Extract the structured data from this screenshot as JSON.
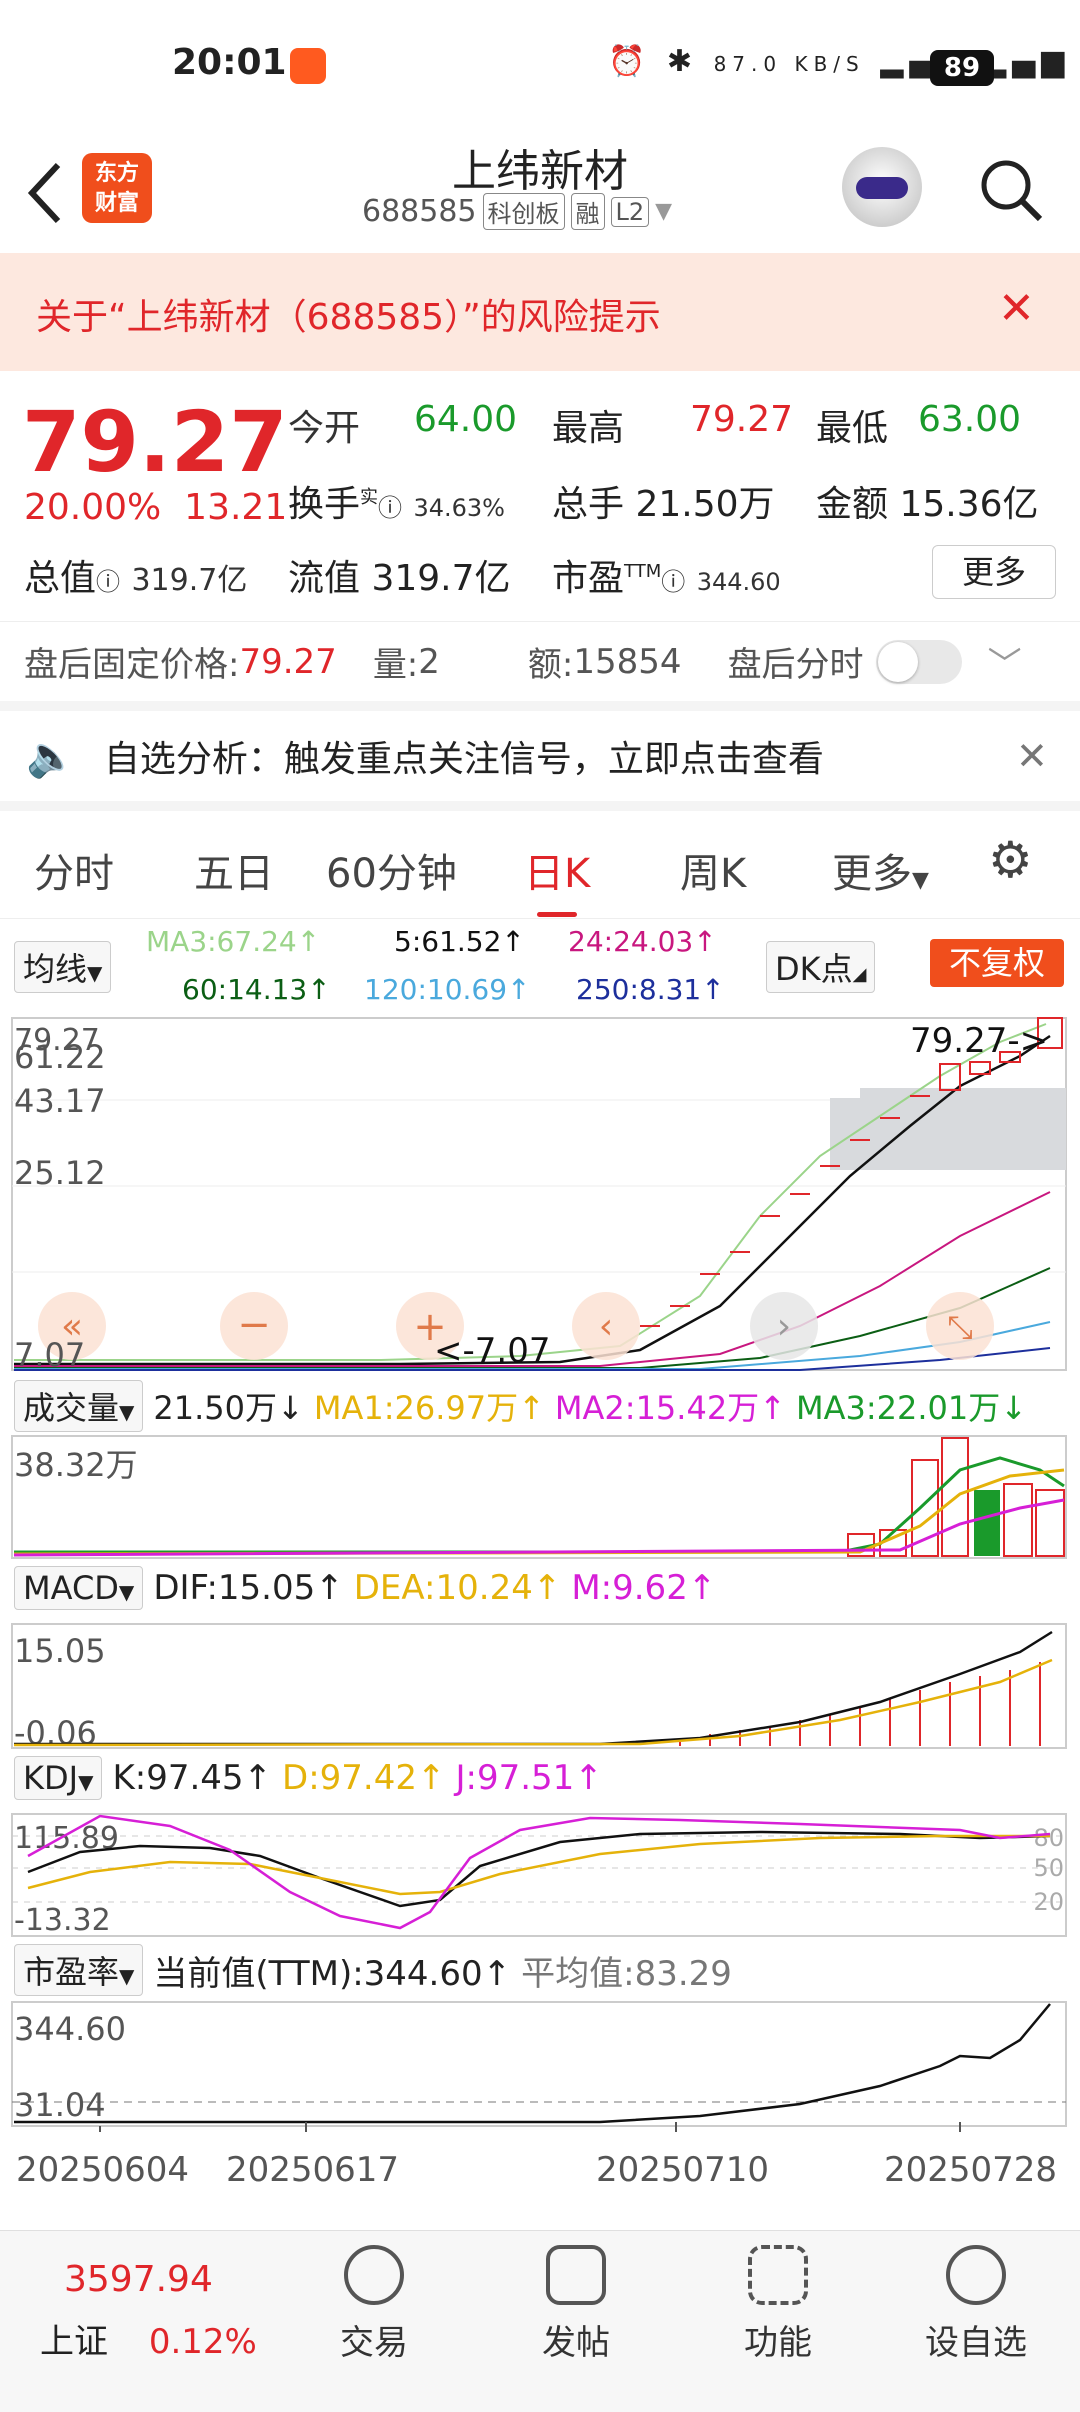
{
  "status_bar": {
    "time": "20:01",
    "network_speed": "87.0 KB/S",
    "battery": "89"
  },
  "header": {
    "title": "上纬新材",
    "code": "688585",
    "tags": [
      "科创板",
      "融",
      "L2"
    ],
    "logo_text": [
      "东方",
      "财富"
    ]
  },
  "risk_banner": {
    "text": "关于“上纬新材（688585）”的风险提示"
  },
  "quote": {
    "price": "79.27",
    "change_pct": "20.00%",
    "change_amt": "13.21",
    "open_label": "今开",
    "open": "64.00",
    "high_label": "最高",
    "high": "79.27",
    "low_label": "最低",
    "low": "63.00",
    "turnover_label": "换手",
    "turnover_sup": "实",
    "turnover": "34.63%",
    "volume_label": "总手",
    "volume": "21.50万",
    "amount_label": "金额",
    "amount": "15.36亿",
    "mktcap_label": "总值",
    "mktcap": "319.7亿",
    "float_label": "流值",
    "float": "319.7亿",
    "pe_label": "市盈",
    "pe_sup": "TTM",
    "pe": "344.60",
    "more_label": "更多"
  },
  "after_hours": {
    "price_label": "盘后固定价格:",
    "price": "79.27",
    "vol_label": "量:",
    "vol": "2",
    "amt_label": "额:",
    "amt": "15854",
    "timeshare_label": "盘后分时"
  },
  "notice": {
    "text": "自选分析：触发重点关注信号，立即点击查看"
  },
  "tabs": [
    "分时",
    "五日",
    "60分钟",
    "日K",
    "周K",
    "更多"
  ],
  "ma_legend": {
    "selector": "均线",
    "ma3": "MA3:67.24↑",
    "ma5": "5:61.52↑",
    "ma24": "24:24.03↑",
    "ma60": "60:14.13↑",
    "ma120": "120:10.69↑",
    "ma250": "250:8.31↑",
    "dk_label": "DK点",
    "fq_label": "不复权"
  },
  "kline": {
    "y_labels": [
      "79.27",
      "61.22",
      "43.17",
      "25.12",
      "7.07"
    ],
    "last_label": "79.27->",
    "low_label": "<-7.07"
  },
  "volume": {
    "selector": "成交量",
    "value": "21.50万↓",
    "ma1": "MA1:26.97万↑",
    "ma2": "MA2:15.42万↑",
    "ma3": "MA3:22.01万↓",
    "y_label": "38.32万"
  },
  "macd": {
    "selector": "MACD",
    "dif": "DIF:15.05↑",
    "dea": "DEA:10.24↑",
    "m": "M:9.62↑",
    "y_top": "15.05",
    "y_bottom": "-0.06"
  },
  "kdj": {
    "selector": "KDJ",
    "k": "K:97.45↑",
    "d": "D:97.42↑",
    "j": "J:97.51↑",
    "y_top": "115.89",
    "y_bottom": "-13.32",
    "levels": [
      "80",
      "50",
      "20"
    ]
  },
  "pe_panel": {
    "selector": "市盈率",
    "current": "当前值(TTM):344.60↑",
    "avg": "平均值:83.29",
    "y_top": "344.60",
    "y_bottom": "31.04"
  },
  "dates": [
    "20250604",
    "20250617",
    "20250710",
    "20250728"
  ],
  "bottom_nav": {
    "index_value": "3597.94",
    "index_name": "上证",
    "index_chg": "0.12%",
    "items": [
      "交易",
      "发帖",
      "功能",
      "设自选"
    ]
  },
  "colors": {
    "up": "#e0262a",
    "down": "#1a9a2b",
    "accent": "#f04e1c"
  }
}
